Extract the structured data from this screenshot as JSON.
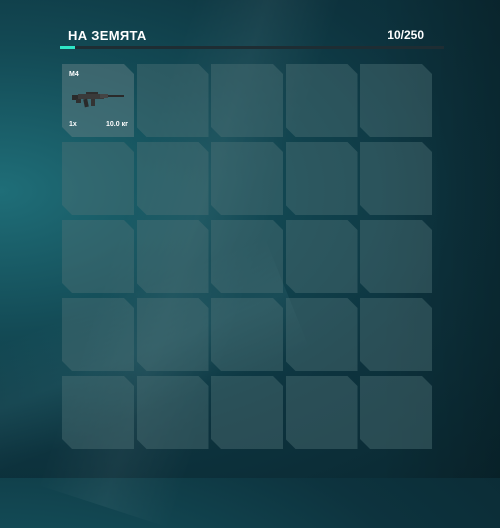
{
  "inventory": {
    "title": "НА ЗЕМЯТА",
    "capacity_text": "10/250",
    "capacity_fraction": 0.04,
    "accent_color": "#2ee6c6",
    "slots": [
      {
        "name": "M4",
        "quantity": "1x",
        "weight": "10.0 кг",
        "icon": "rifle-icon"
      },
      {},
      {},
      {},
      {},
      {},
      {},
      {},
      {},
      {},
      {},
      {},
      {},
      {},
      {},
      {},
      {},
      {},
      {},
      {},
      {},
      {},
      {},
      {},
      {}
    ]
  }
}
